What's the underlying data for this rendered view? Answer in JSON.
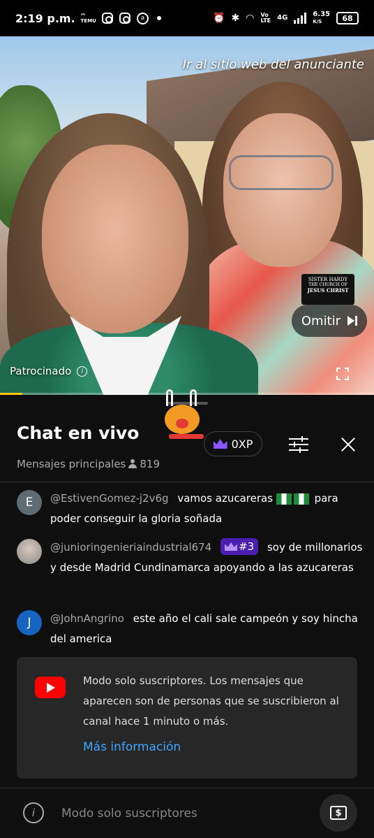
{
  "status_bar": {
    "time": "2:19 p.m.",
    "app_label_top": "ᵃᵇ",
    "app_label": "TEMU",
    "circle_label": "a",
    "net_top": "Vo",
    "net_bottom": "LTE",
    "net_type": "4G",
    "speed": "6.35",
    "speed_unit": "K/S",
    "battery": "68"
  },
  "video": {
    "advertiser_link": "Ir al sitio web del anunciante",
    "skip_label": "Omitir",
    "sponsored_label": "Patrocinado",
    "info_glyph": "i",
    "progress_fraction": 0.06,
    "tag_line1": "SISTER HARDY",
    "tag_line2": "THE CHURCH OF",
    "tag_line3": "JESUS CHRIST",
    "accent_color": "#f7c400"
  },
  "chat": {
    "title": "Chat en vivo",
    "subtitle": "Mensajes principales",
    "viewer_count": "819",
    "xp_label": "0XP",
    "messages": [
      {
        "avatar_letter": "E",
        "avatar_color": "#5f6b73",
        "author": "@EstivenGomez-j2v6g",
        "text_before_flags": "vamos azucareras",
        "text_after_flags": "para poder conseguir la gloria soñada"
      },
      {
        "avatar_letter": "",
        "avatar_color": "#8a8a8a",
        "author": "@junioringenieriaindustrial674",
        "badge": "#3",
        "text": "soy de millonarios y desde Madrid Cundinamarca apoyando a las azucareras"
      },
      {
        "avatar_letter": "J",
        "avatar_color": "#1565c0",
        "author": "@JohnAngrino",
        "text": "este año el cali sale campeón y soy hincha del america"
      }
    ],
    "notice": {
      "text": "Modo solo suscriptores. Los mensajes que aparecen son de personas que se suscribieron al canal hace 1 minuto o más.",
      "link": "Más información"
    },
    "input": {
      "placeholder": "Modo solo suscriptores",
      "info_glyph": "i",
      "super_chat_glyph": "$"
    }
  }
}
